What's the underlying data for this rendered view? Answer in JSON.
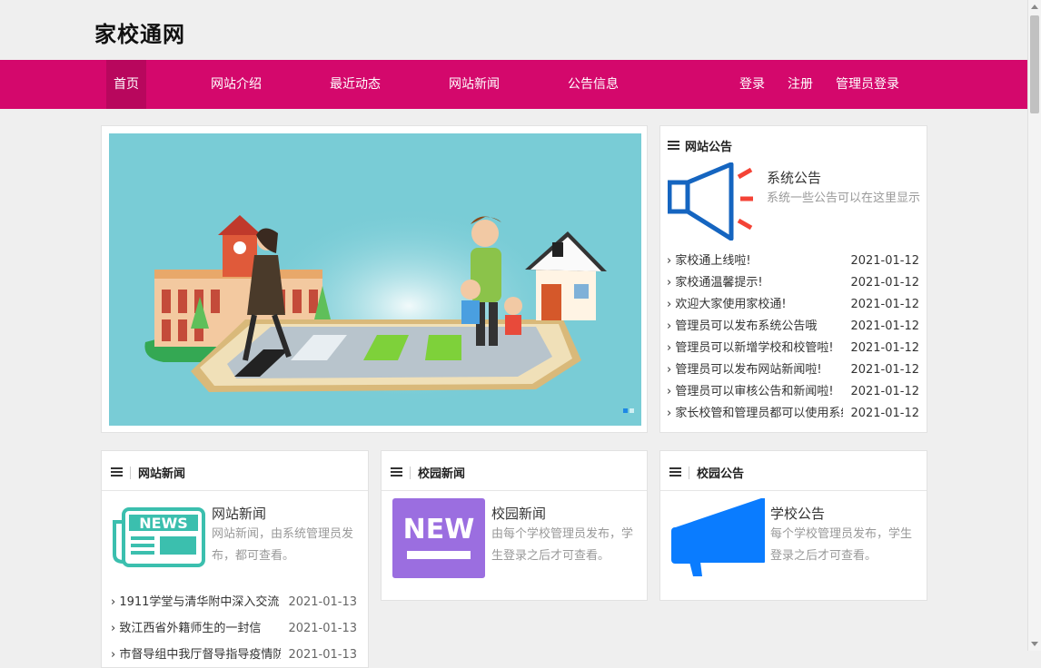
{
  "site": {
    "title": "家校通网"
  },
  "nav": {
    "items": [
      "首页",
      "网站介绍",
      "最近动态",
      "网站新闻",
      "公告信息"
    ],
    "right": [
      "登录",
      "注册",
      "管理员登录"
    ]
  },
  "notice_panel": {
    "title": "网站公告",
    "feature_title": "系统公告",
    "feature_desc": "系统一些公告可以在这里显示",
    "rows": [
      {
        "text": "› 家校通上线啦!",
        "date": "2021-01-12"
      },
      {
        "text": "› 家校通温馨提示!",
        "date": "2021-01-12"
      },
      {
        "text": "› 欢迎大家使用家校通!",
        "date": "2021-01-12"
      },
      {
        "text": "› 管理员可以发布系统公告哦",
        "date": "2021-01-12"
      },
      {
        "text": "› 管理员可以新增学校和校管啦!",
        "date": "2021-01-12"
      },
      {
        "text": "› 管理员可以发布网站新闻啦!",
        "date": "2021-01-12"
      },
      {
        "text": "› 管理员可以审核公告和新闻啦!",
        "date": "2021-01-12"
      },
      {
        "text": "› 家长校管和管理员都可以使用系统哦",
        "date": "2021-01-12"
      }
    ]
  },
  "news_panel": {
    "title": "网站新闻",
    "icon_text": "NEWS",
    "feature_title": "网站新闻",
    "feature_desc": "网站新闻，由系统管理员发布，都可查看。",
    "rows": [
      {
        "text": "› 1911学堂与清华附中深入交流",
        "date": "2021-01-13"
      },
      {
        "text": "› 致江西省外籍师生的一封信",
        "date": "2021-01-13"
      },
      {
        "text": "› 市督导组中我厅督导指导疫情防控",
        "date": "2021-01-13"
      }
    ]
  },
  "campus_news_panel": {
    "title": "校园新闻",
    "icon_text": "NEW",
    "feature_title": "校园新闻",
    "feature_desc": "由每个学校管理员发布，学生登录之后才可查看。"
  },
  "campus_notice_panel": {
    "title": "校园公告",
    "feature_title": "学校公告",
    "feature_desc": "每个学校管理员发布，学生登录之后才可查看。"
  },
  "colors": {
    "nav_bg": "#d4086c",
    "nav_active": "#b8075d",
    "carousel_bg": "#79ccd6",
    "news_icon": "#3bbfae",
    "new_icon": "#9b6ee0",
    "megaphone": "#0a7cff"
  },
  "carousel": {
    "slide_count": 2,
    "active_slide": 1
  }
}
